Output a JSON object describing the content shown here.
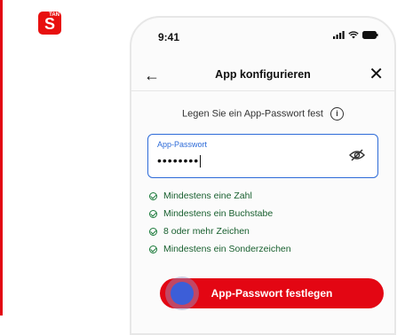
{
  "app_icon": {
    "badge": "TAN",
    "glyph": "S"
  },
  "status_bar": {
    "time": "9:41"
  },
  "nav": {
    "title": "App konfigurieren"
  },
  "hint": {
    "text": "Legen Sie ein App-Passwort fest"
  },
  "password_field": {
    "label": "App-Passwort",
    "value": "••••••••"
  },
  "rules": [
    {
      "label": "Mindestens eine Zahl"
    },
    {
      "label": "Mindestens ein Buchstabe"
    },
    {
      "label": "8 oder mehr Zeichen"
    },
    {
      "label": "Mindestens ein Sonderzeichen"
    }
  ],
  "button": {
    "label": "App-Passwort festlegen"
  },
  "colors": {
    "brand_red": "#e30613",
    "focus_blue": "#2d6bd8",
    "success_green": "#1a7a3a"
  }
}
